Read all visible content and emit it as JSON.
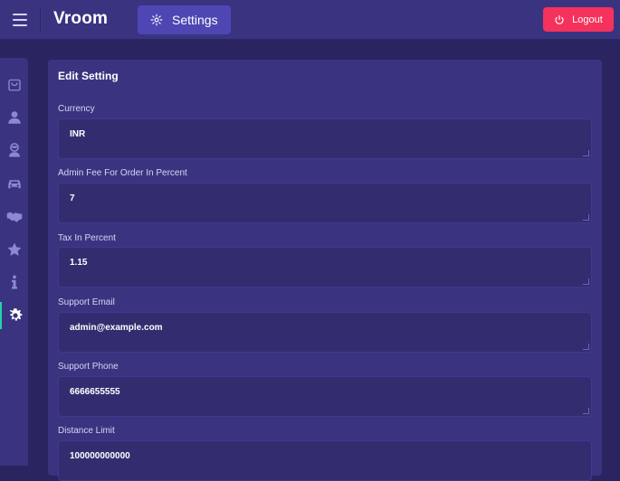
{
  "header": {
    "brand": "Vroom",
    "active_tab_label": "Settings",
    "logout_label": "Logout",
    "icons": [
      "menu-icon",
      "settings-gear-icon",
      "power-icon"
    ]
  },
  "sidebar": {
    "items": [
      {
        "name": "orders",
        "icon": "shopping-bag-icon",
        "active": false
      },
      {
        "name": "users",
        "icon": "user-icon",
        "active": false
      },
      {
        "name": "drivers",
        "icon": "driver-icon",
        "active": false
      },
      {
        "name": "vehicles",
        "icon": "car-icon",
        "active": false
      },
      {
        "name": "partners",
        "icon": "handshake-icon",
        "active": false
      },
      {
        "name": "reviews",
        "icon": "star-icon",
        "active": false
      },
      {
        "name": "info",
        "icon": "info-icon",
        "active": false
      },
      {
        "name": "settings",
        "icon": "gear-icon",
        "active": true
      }
    ],
    "accent": "#22d3a5"
  },
  "form": {
    "title": "Edit Setting",
    "fields": [
      {
        "label": "Currency",
        "value": "INR"
      },
      {
        "label": "Admin Fee For Order In Percent",
        "value": "7"
      },
      {
        "label": "Tax In Percent",
        "value": "1.15"
      },
      {
        "label": "Support Email",
        "value": "admin@example.com"
      },
      {
        "label": "Support Phone",
        "value": "6666655555"
      },
      {
        "label": "Distance Limit",
        "value": "100000000000"
      }
    ]
  },
  "colors": {
    "background": "#2a2560",
    "panel": "#3a3480",
    "input": "#332d70",
    "active_tab": "#4d46b3",
    "logout": "#f5325c"
  }
}
